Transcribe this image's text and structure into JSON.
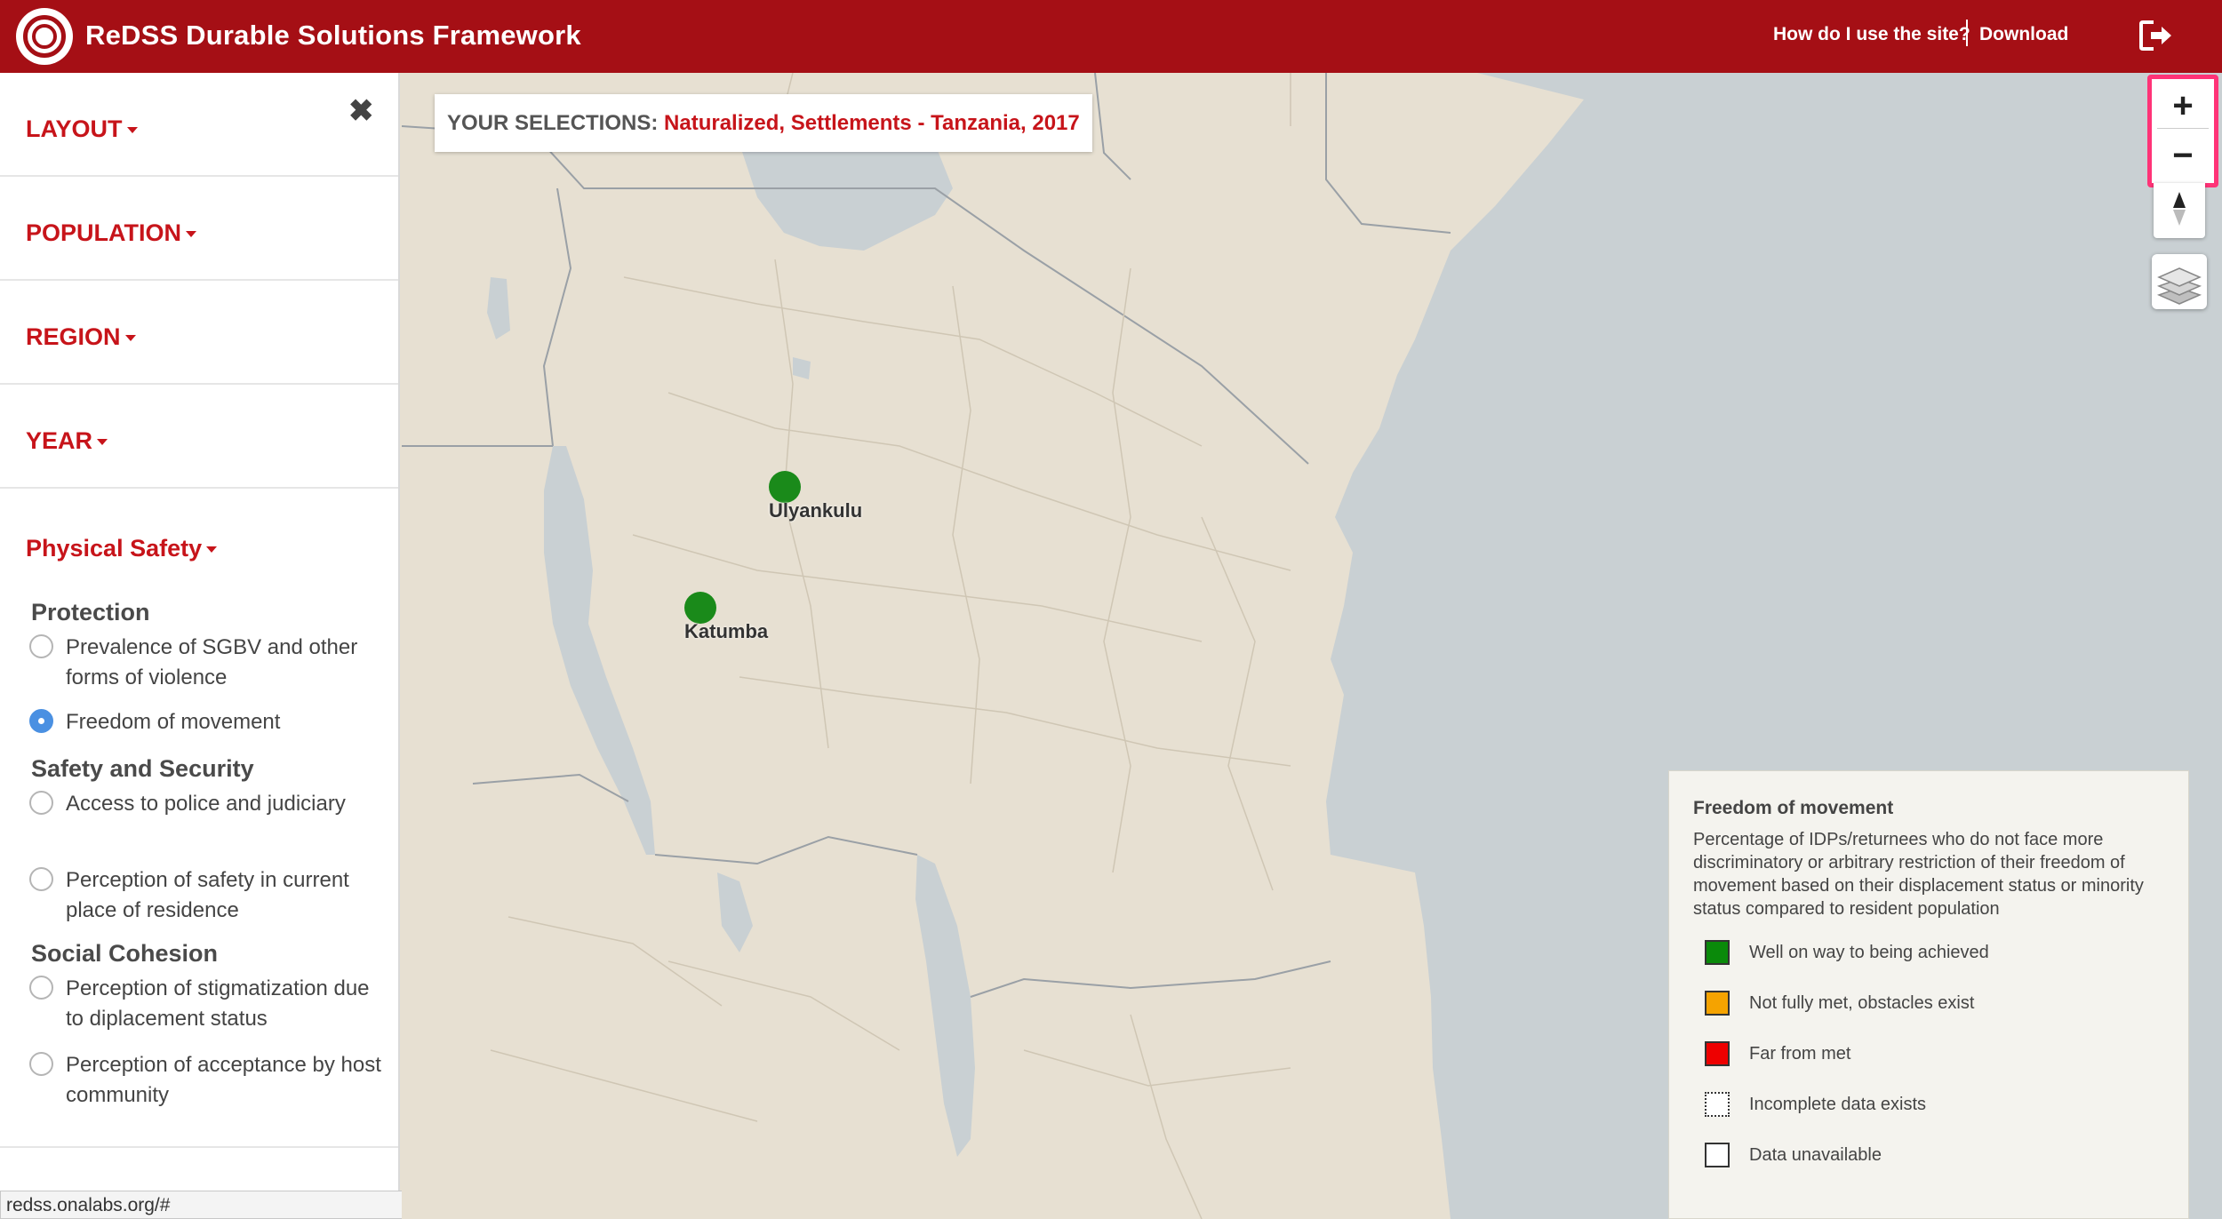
{
  "header": {
    "title": "ReDSS Durable Solutions Framework",
    "help_link": "How do I use the site?",
    "download_link": "Download"
  },
  "sidebar": {
    "sections": [
      {
        "label": "LAYOUT"
      },
      {
        "label": "POPULATION"
      },
      {
        "label": "REGION"
      },
      {
        "label": "YEAR"
      }
    ],
    "active_section": "Physical Safety",
    "groups": [
      {
        "title": "Protection",
        "options": [
          {
            "label": "Prevalence of SGBV and other forms of violence",
            "selected": false
          },
          {
            "label": "Freedom of movement",
            "selected": true
          }
        ]
      },
      {
        "title": "Safety and Security",
        "options": [
          {
            "label": "Access to police and judiciary",
            "selected": false
          },
          {
            "label": "Perception of safety in current place of residence",
            "selected": false
          }
        ]
      },
      {
        "title": "Social Cohesion",
        "options": [
          {
            "label": "Perception of stigmatization due to diplacement status",
            "selected": false
          },
          {
            "label": "Perception of acceptance by host community",
            "selected": false
          }
        ]
      }
    ]
  },
  "status_bar": {
    "url": "redss.onalabs.org/#"
  },
  "selections": {
    "label": "YOUR SELECTIONS:",
    "value": "Naturalized, Settlements - Tanzania, 2017"
  },
  "map": {
    "markers": [
      {
        "name": "Ulyankulu",
        "status_color": "#1a8a1a"
      },
      {
        "name": "Katumba",
        "status_color": "#1a8a1a"
      }
    ],
    "controls": {
      "zoom_in": "+",
      "zoom_out": "−"
    }
  },
  "legend": {
    "title": "Freedom of movement",
    "description": "Percentage of IDPs/returnees who do not face more discriminatory or arbitrary restriction of their freedom of movement based on their displacement status or minority status compared to resident population",
    "items": [
      {
        "label": "Well on way to being achieved",
        "color": "#0a8a0a"
      },
      {
        "label": "Not fully met, obstacles exist",
        "color": "#f5a300"
      },
      {
        "label": "Far from met",
        "color": "#ee0000"
      },
      {
        "label": "Incomplete data exists",
        "color": "#ffffff"
      },
      {
        "label": "Data unavailable",
        "color": "#ffffff"
      }
    ]
  },
  "colors": {
    "brand_red": "#a50f15",
    "accent_red": "#c7141a",
    "land": "#e7e0d2",
    "water": "#c9d0d3"
  }
}
